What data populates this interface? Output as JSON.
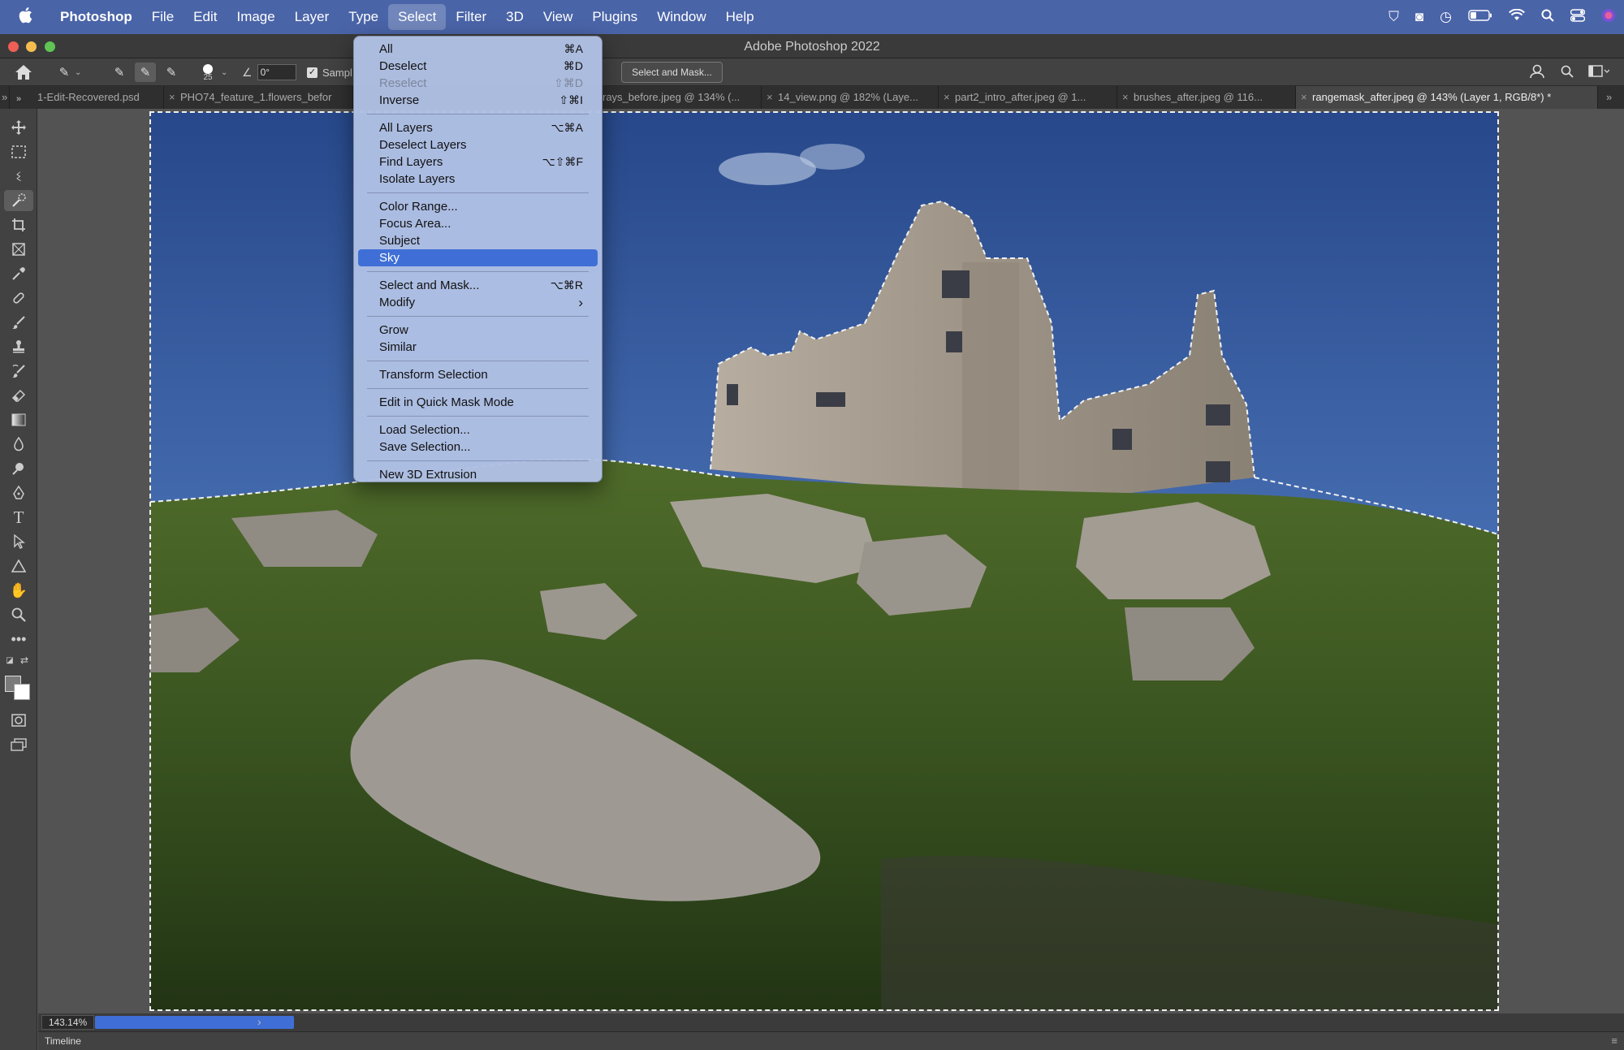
{
  "menubar": {
    "apple": "",
    "items": [
      {
        "label": "Photoshop"
      },
      {
        "label": "File"
      },
      {
        "label": "Edit"
      },
      {
        "label": "Image"
      },
      {
        "label": "Layer"
      },
      {
        "label": "Type"
      },
      {
        "label": "Select"
      },
      {
        "label": "Filter"
      },
      {
        "label": "3D"
      },
      {
        "label": "View"
      },
      {
        "label": "Plugins"
      },
      {
        "label": "Window"
      },
      {
        "label": "Help"
      }
    ],
    "active": "Select"
  },
  "window": {
    "title": "Adobe Photoshop 2022"
  },
  "options": {
    "brush_size": "25",
    "angle_value": "0°",
    "sample_label": "Sampl",
    "select_mask_label": "Select and Mask..."
  },
  "tabs": [
    {
      "label": "1-Edit-Recovered.psd"
    },
    {
      "label": "PHO74_feature_1.flowers_befor"
    },
    {
      "label": "rays_before.jpeg @ 134% (..."
    },
    {
      "label": "14_view.png @ 182% (Laye..."
    },
    {
      "label": "part2_intro_after.jpeg @ 1..."
    },
    {
      "label": "brushes_after.jpeg @ 116..."
    },
    {
      "label": "rangemask_after.jpeg @ 143% (Layer 1, RGB/8*) *"
    }
  ],
  "select_menu": {
    "items": [
      {
        "label": "All",
        "shortcut": "⌘A"
      },
      {
        "label": "Deselect",
        "shortcut": "⌘D"
      },
      {
        "label": "Reselect",
        "shortcut": "⇧⌘D",
        "disabled": true
      },
      {
        "label": "Inverse",
        "shortcut": "⇧⌘I"
      },
      {
        "label": "All Layers",
        "shortcut": "⌥⌘A"
      },
      {
        "label": "Deselect Layers",
        "shortcut": ""
      },
      {
        "label": "Find Layers",
        "shortcut": "⌥⇧⌘F"
      },
      {
        "label": "Isolate Layers",
        "shortcut": ""
      },
      {
        "label": "Color Range...",
        "shortcut": ""
      },
      {
        "label": "Focus Area...",
        "shortcut": ""
      },
      {
        "label": "Subject",
        "shortcut": ""
      },
      {
        "label": "Sky",
        "shortcut": "",
        "highlighted": true
      },
      {
        "label": "Select and Mask...",
        "shortcut": "⌥⌘R"
      },
      {
        "label": "Modify",
        "shortcut": "›"
      },
      {
        "label": "Grow",
        "shortcut": ""
      },
      {
        "label": "Similar",
        "shortcut": ""
      },
      {
        "label": "Transform Selection",
        "shortcut": ""
      },
      {
        "label": "Edit in Quick Mask Mode",
        "shortcut": ""
      },
      {
        "label": "Load Selection...",
        "shortcut": ""
      },
      {
        "label": "Save Selection...",
        "shortcut": ""
      },
      {
        "label": "New 3D Extrusion",
        "shortcut": ""
      }
    ]
  },
  "status": {
    "zoom": "143.14%"
  },
  "timeline": {
    "label": "Timeline"
  },
  "colors": {
    "accent": "#3f6fd6",
    "menubar": "#4a64a8",
    "sky": "#2f5593"
  }
}
